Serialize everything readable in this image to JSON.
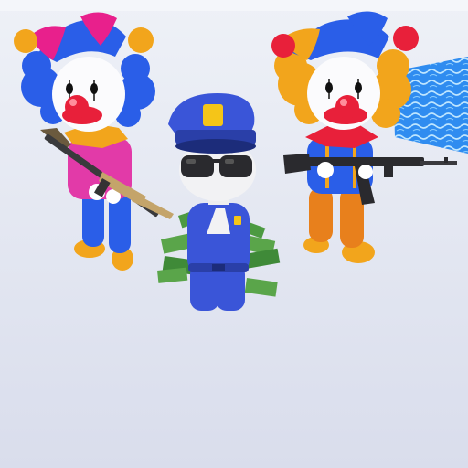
{
  "scene": {
    "ground_color": "#dfe3f0",
    "horizon_color": "#eceff6",
    "water_color": "#2f8cf0",
    "water_highlight": "#bfe6ff"
  },
  "characters": [
    {
      "role": "clown",
      "hat_colors": [
        "#e8208c",
        "#2a5ee8"
      ],
      "hat_ball_color": "#f2a51c",
      "hair_color": "#2a5ee8",
      "suit_top_color": "#e23aa8",
      "suit_bottom_color": "#2a5ee8",
      "collar_color": "#f2a51c",
      "shoe_color": "#f2a51c",
      "weapon": "rifle-icon"
    },
    {
      "role": "police-officer",
      "uniform_color": "#3a55d8",
      "badge_color": "#f5c518",
      "skin_color": "#f2f2f4",
      "sunglasses": "sunglasses-icon",
      "props": "cash-stack-icon"
    },
    {
      "role": "clown",
      "hat_colors": [
        "#2a5ee8",
        "#f2a51c"
      ],
      "hat_ball_color": "#e8203a",
      "hair_color": "#f2a51c",
      "suit_top_color": "#2a5ee8",
      "suit_bottom_color": "#e8801c",
      "collar_color": "#e8203a",
      "shoe_color": "#f2a51c",
      "weapon": "assault-rifle-icon"
    }
  ]
}
